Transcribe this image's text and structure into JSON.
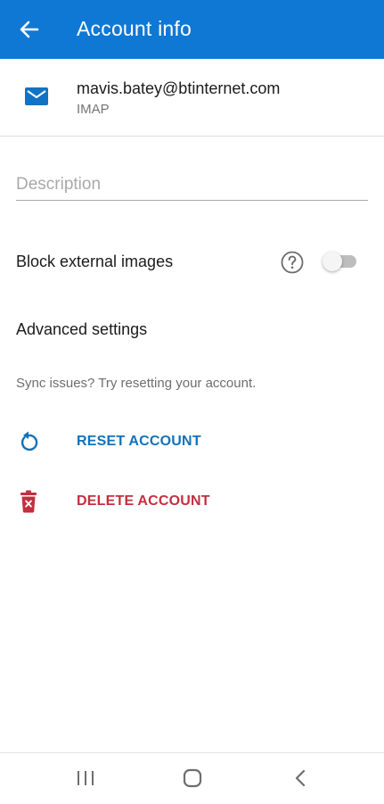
{
  "header": {
    "title": "Account info",
    "background": "#0f78d4"
  },
  "account": {
    "email": "mavis.batey@btinternet.com",
    "type": "IMAP",
    "icon": "mail-icon"
  },
  "description": {
    "placeholder": "Description",
    "value": ""
  },
  "block_external_images": {
    "label": "Block external images",
    "enabled": false,
    "help_icon": "help-circle-icon"
  },
  "advanced_settings": {
    "label": "Advanced settings"
  },
  "sync_hint": "Sync issues? Try resetting your account.",
  "actions": {
    "reset": {
      "label": "RESET ACCOUNT",
      "color": "#1272b8",
      "icon": "reset-icon"
    },
    "delete": {
      "label": "DELETE ACCOUNT",
      "color": "#c2303f",
      "icon": "trash-icon"
    }
  },
  "system_nav": {
    "recents_icon": "recents-icon",
    "home_icon": "home-icon",
    "back_icon": "back-chevron-icon"
  }
}
